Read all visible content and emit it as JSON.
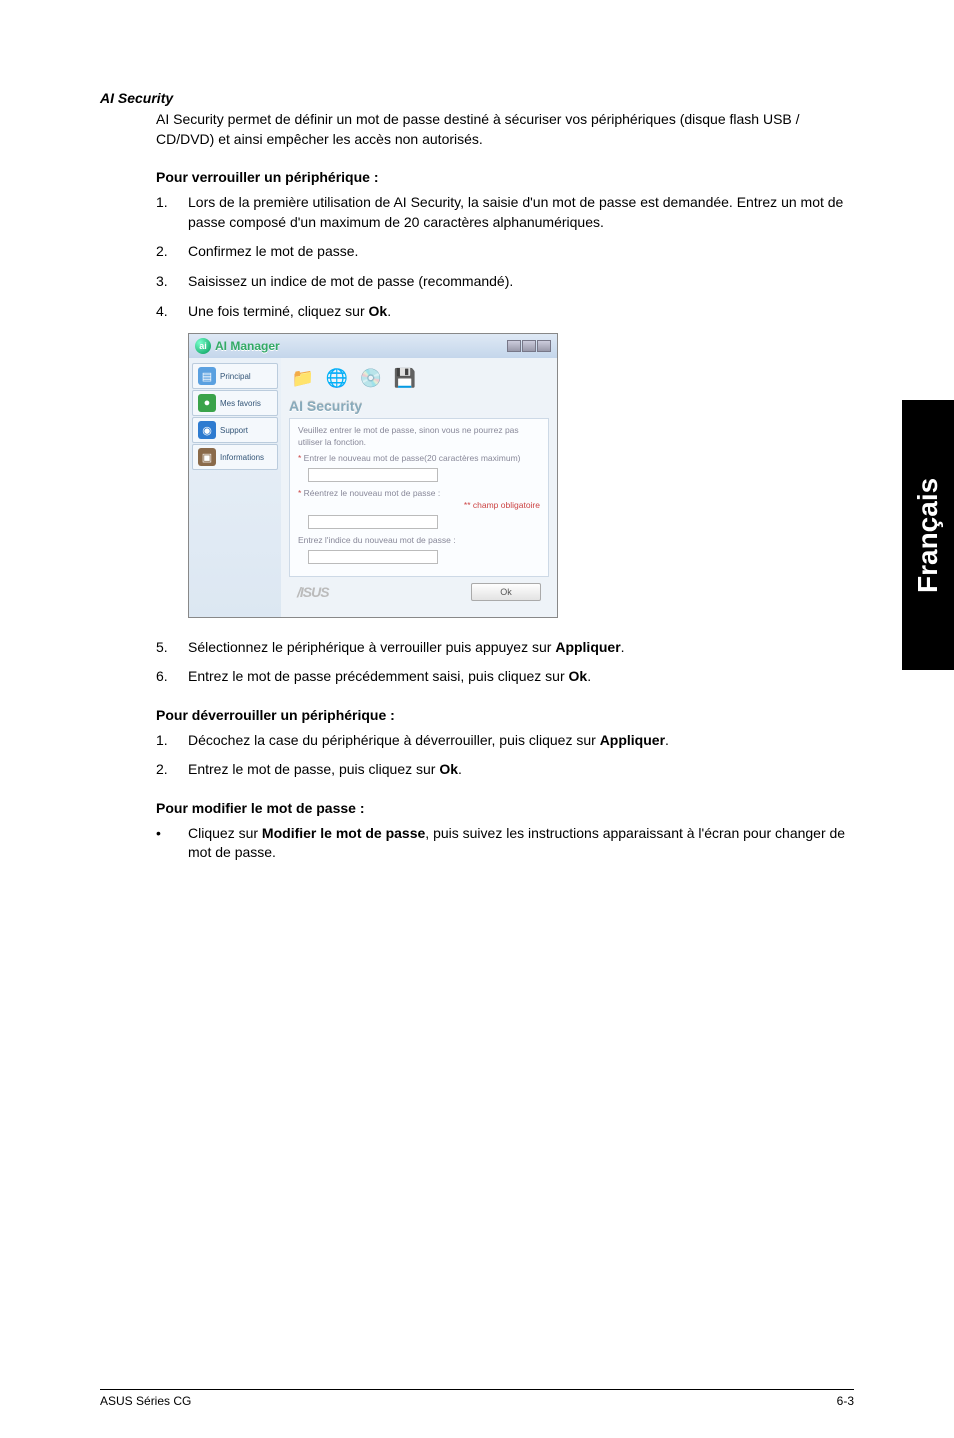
{
  "section": {
    "title": "AI Security",
    "intro": "AI Security permet de définir un mot de passe destiné à sécuriser vos périphériques (disque flash USB / CD/DVD) et ainsi empêcher les accès non autorisés."
  },
  "lock": {
    "heading": "Pour verrouiller un périphérique :",
    "steps": [
      {
        "n": "1.",
        "t": "Lors de la première utilisation de AI Security, la saisie d'un mot de passe est demandée. Entrez un mot de passe composé d'un maximum de 20 caractères alphanumériques."
      },
      {
        "n": "2.",
        "t": "Confirmez le mot de passe."
      },
      {
        "n": "3.",
        "t": "Saisissez un indice de mot de passe (recommandé)."
      },
      {
        "n": "4.",
        "t_pre": "Une fois terminé, cliquez sur ",
        "bold": "Ok",
        "t_post": "."
      }
    ],
    "steps2": [
      {
        "n": "5.",
        "t_pre": "Sélectionnez le périphérique à verrouiller puis appuyez sur ",
        "bold": "Appliquer",
        "t_post": "."
      },
      {
        "n": "6.",
        "t_pre": "Entrez le mot de passe précédemment saisi, puis cliquez sur ",
        "bold": "Ok",
        "t_post": "."
      }
    ]
  },
  "unlock": {
    "heading": "Pour déverrouiller un périphérique :",
    "steps": [
      {
        "n": "1.",
        "t_pre": "Décochez la case du périphérique à déverrouiller, puis cliquez sur ",
        "bold": "Appliquer",
        "t_post": "."
      },
      {
        "n": "2.",
        "t_pre": "Entrez le mot de passe, puis cliquez sur ",
        "bold": "Ok",
        "t_post": "."
      }
    ]
  },
  "modify": {
    "heading": "Pour modifier le mot de passe :",
    "bullet": {
      "dot": "•",
      "pre": "Cliquez sur ",
      "bold": "Modifier le mot de passe",
      "post": ", puis suivez les instructions apparaissant à l'écran pour changer de mot de passe."
    }
  },
  "screenshot": {
    "title": "AI Manager",
    "sidebar": [
      {
        "icon": "📘",
        "label": "Principal",
        "bg": "#5aa0e0"
      },
      {
        "icon": "🟢",
        "label": "Mes favoris",
        "bg": "#3aa34a"
      },
      {
        "icon": "🔵",
        "label": "Support",
        "bg": "#2e7bd0"
      },
      {
        "icon": "🖼",
        "label": "Informations",
        "bg": "#8a6a4a"
      }
    ],
    "toolbar_icons": [
      "folder-icon",
      "globe-icon",
      "disc-icon",
      "drive-icon"
    ],
    "toolbar_colors": [
      "#e6a52b",
      "#3a9a3a",
      "#2bb0e6",
      "#3a5aa0"
    ],
    "toolbar_glyphs": [
      "📁",
      "🌐",
      "💿",
      "💾"
    ],
    "panel_title": "AI Security",
    "panel_intro": "Veuillez entrer le mot de passe, sinon vous ne pourrez pas utiliser la fonction.",
    "line1": "Entrer le nouveau mot de passe(20 caractères maximum)",
    "line2": "Réentrez le nouveau mot de passe :",
    "req": "** champ obligatoire",
    "line3": "Entrez l'indice du nouveau mot de passe :",
    "brand": "/ISUS",
    "ok": "Ok"
  },
  "sidetab": "Français",
  "footer": {
    "left": "ASUS Séries CG",
    "right": "6-3"
  }
}
